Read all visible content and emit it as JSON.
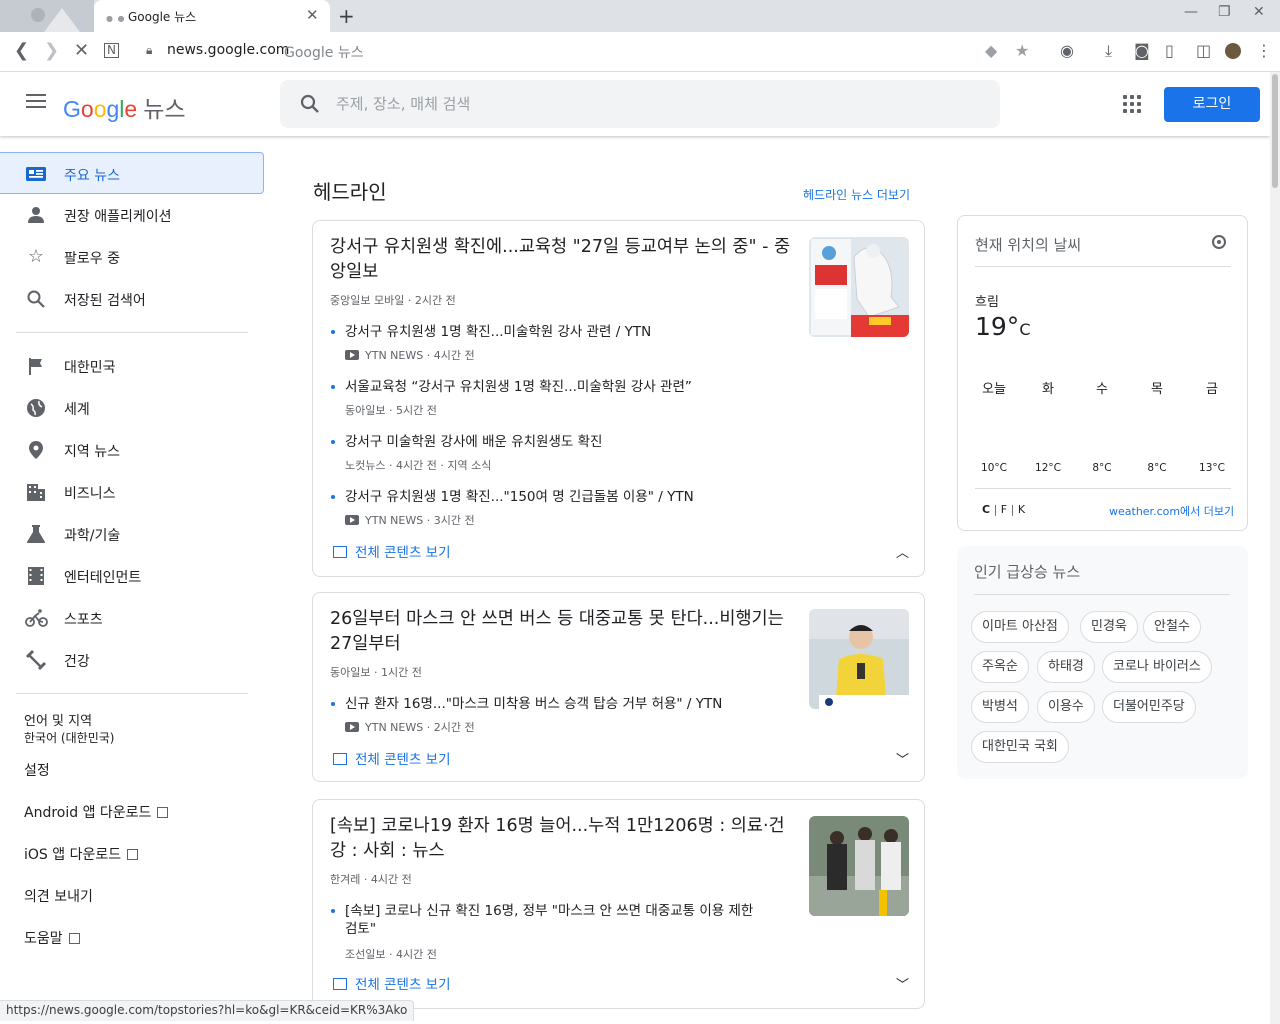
{
  "browser": {
    "tab_title": "Google 뉴스",
    "url_host": "news.google.com",
    "url_title": "Google 뉴스",
    "status_url": "https://news.google.com/topstories?hl=ko&gl=KR&ceid=KR%3Ako"
  },
  "header": {
    "logo_news": "뉴스",
    "search_placeholder": "주제, 장소, 매체 검색",
    "login": "로그인"
  },
  "sidebar": {
    "primary": [
      {
        "label": "주요 뉴스",
        "icon": "top-stories-icon"
      },
      {
        "label": "권장 애플리케이션",
        "icon": "person-icon"
      },
      {
        "label": "팔로우 중",
        "icon": "star-icon"
      },
      {
        "label": "저장된 검색어",
        "icon": "search-icon"
      }
    ],
    "sections": [
      {
        "label": "대한민국",
        "icon": "flag-icon"
      },
      {
        "label": "세계",
        "icon": "globe-icon"
      },
      {
        "label": "지역 뉴스",
        "icon": "location-pin-icon"
      },
      {
        "label": "비즈니스",
        "icon": "building-icon"
      },
      {
        "label": "과학/기술",
        "icon": "flask-icon"
      },
      {
        "label": "엔터테인먼트",
        "icon": "film-icon"
      },
      {
        "label": "스포츠",
        "icon": "bicycle-icon"
      },
      {
        "label": "건강",
        "icon": "dumbbell-icon"
      }
    ],
    "language_title": "언어 및 지역",
    "language_value": "한국어 (대한민국)",
    "settings": "설정",
    "android": "Android 앱 다운로드",
    "ios": "iOS 앱 다운로드",
    "feedback": "의견 보내기",
    "help": "도움말"
  },
  "main": {
    "section_title": "헤드라인",
    "more_link": "헤드라인 뉴스 더보기",
    "full_coverage": "전체 콘텐츠 보기",
    "cards": [
      {
        "headline": "강서구 유치원생 확진에...교육청 \"27일 등교여부 논의 중\" - 중앙일보",
        "source": "중앙일보 모바일",
        "time": "2시간 전",
        "subs": [
          {
            "title": "강서구 유치원생 1명 확진...미술학원 강사 관련 / YTN",
            "source": "YTN NEWS",
            "time": "4시간 전",
            "video": true
          },
          {
            "title": "서울교육청 “강서구 유치원생 1명 확진...미술학원 강사 관련”",
            "source": "동아일보",
            "time": "5시간 전"
          },
          {
            "title": "강서구 미술학원 강사에 배운 유치원생도 확진",
            "source": "노컷뉴스",
            "time": "4시간 전",
            "extra": "지역 소식"
          },
          {
            "title": "강서구 유치원생 1명 확진...\"150여 명 긴급돌봄 이용\" / YTN",
            "source": "YTN NEWS",
            "time": "3시간 전",
            "video": true
          }
        ]
      },
      {
        "headline": "26일부터 마스크 안 쓰면 버스 등 대중교통 못 탄다...비행기는 27일부터",
        "source": "동아일보",
        "time": "1시간 전",
        "subs": [
          {
            "title": "신규 환자 16명...\"마스크 미착용 버스 승객 탑승 거부 허용\" / YTN",
            "source": "YTN NEWS",
            "time": "2시간 전",
            "video": true
          }
        ]
      },
      {
        "headline": "[속보] 코로나19 환자 16명 늘어...누적 1만1206명 : 의료·건강 : 사회 : 뉴스",
        "source": "한겨레",
        "time": "4시간 전",
        "subs": [
          {
            "title": "[속보] 코로나 신규 확진 16명, 정부 \"마스크 안 쓰면 대중교통 이용 제한 검토\"",
            "source": "조선일보",
            "time": "4시간 전"
          }
        ]
      }
    ]
  },
  "weather": {
    "title": "현재 위치의 날씨",
    "condition": "흐림",
    "temp": "19°",
    "unit": "C",
    "days": [
      "오늘",
      "화",
      "수",
      "목",
      "금"
    ],
    "temps": [
      "10°C",
      "12°C",
      "8°C",
      "8°C",
      "13°C"
    ],
    "units": [
      "C",
      "F",
      "K"
    ],
    "link": "weather.com에서 더보기"
  },
  "trending": {
    "title": "인기 급상승 뉴스",
    "chips": [
      "이마트 아산점",
      "민경욱",
      "안철수",
      "주옥순",
      "하태경",
      "코로나 바이러스",
      "박병석",
      "이용수",
      "더불어민주당",
      "대한민국 국회"
    ]
  },
  "colors": {
    "accent": "#1a73e8",
    "active_bg": "#e8f0fe"
  }
}
